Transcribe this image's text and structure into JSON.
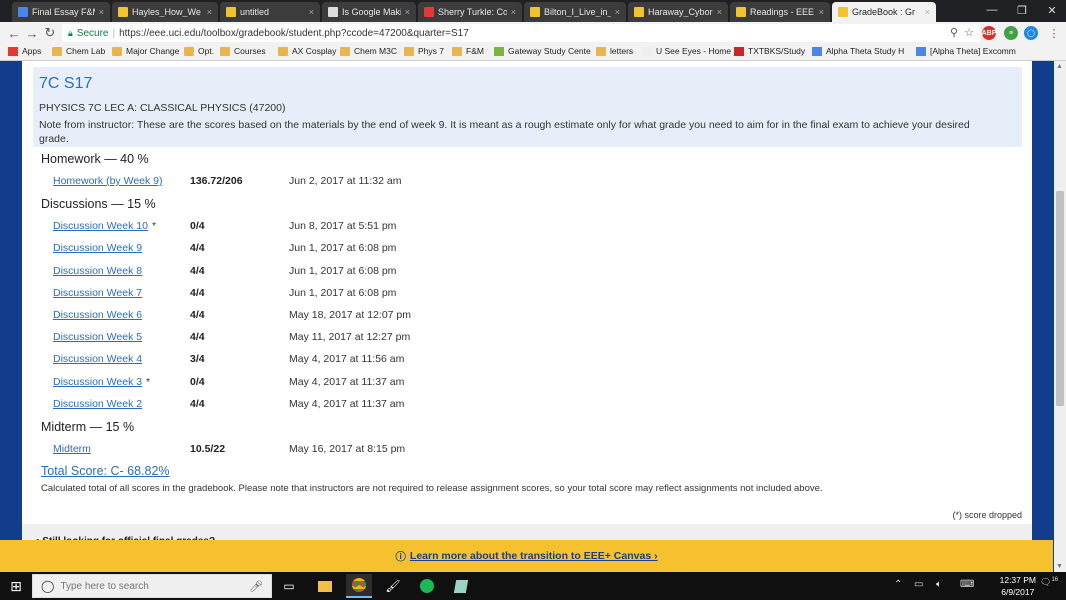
{
  "tabs": [
    {
      "label": "Final Essay F&M",
      "color": "#4a86e8"
    },
    {
      "label": "Hayles_How_We",
      "color": "#f1c232"
    },
    {
      "label": "untitled",
      "color": "#f1c232"
    },
    {
      "label": "Is Google Makin",
      "color": "#dddddd"
    },
    {
      "label": "Sherry Turkle: Co",
      "color": "#e53935"
    },
    {
      "label": "Bilton_I_Live_in_t",
      "color": "#f1c232"
    },
    {
      "label": "Haraway_Cyborg",
      "color": "#f1c232"
    },
    {
      "label": "Readings - EEE",
      "color": "#f1c232"
    },
    {
      "label": "GradeBook : Gr",
      "color": "#f1c232"
    }
  ],
  "window_controls": {
    "minimize": "—",
    "restore": "❐",
    "close": "✕"
  },
  "omnibox": {
    "secure_label": "Secure",
    "url": "https://eee.uci.edu/toolbox/gradebook/student.php?ccode=47200&quarter=S17"
  },
  "extensions": [
    {
      "label": "ABP",
      "color": "#d32f2f"
    },
    {
      "label": "≡",
      "color": "#43a047"
    },
    {
      "label": "◯",
      "color": "#1e88e5"
    }
  ],
  "bookmarks": [
    {
      "label": "Apps",
      "type": "apps"
    },
    {
      "label": "Chem Lab",
      "type": "folder"
    },
    {
      "label": "Major Change",
      "type": "folder"
    },
    {
      "label": "Opt.",
      "type": "folder"
    },
    {
      "label": "Courses",
      "type": "folder"
    },
    {
      "label": "AX Cosplay",
      "type": "folder"
    },
    {
      "label": "Chem M3C",
      "type": "folder"
    },
    {
      "label": "Phys 7",
      "type": "folder"
    },
    {
      "label": "F&M",
      "type": "folder"
    },
    {
      "label": "Gateway Study Cente",
      "type": "site"
    },
    {
      "label": "letters",
      "type": "folder"
    },
    {
      "label": "U See Eyes - Home",
      "type": "doc"
    },
    {
      "label": "TXTBKS/Study",
      "type": "gmail"
    },
    {
      "label": "Alpha Theta Study H",
      "type": "docs"
    },
    {
      "label": "[Alpha Theta] Excomm",
      "type": "docs"
    }
  ],
  "course": {
    "code": "7C S17",
    "name": "PHYSICS 7C LEC A: CLASSICAL PHYSICS (47200)",
    "note": "Note from instructor: These are the scores based on the materials by the end of week 9. It is meant as a rough estimate only for what grade you need to aim for in the final exam to achieve your desired grade."
  },
  "categories": [
    {
      "title": "Homework — 40 %",
      "items": [
        {
          "name": "Homework (by Week 9)",
          "dropped": "",
          "score": "136.72/206",
          "date": "Jun 2, 2017 at 11:32 am"
        }
      ]
    },
    {
      "title": "Discussions — 15 %",
      "items": [
        {
          "name": "Discussion Week 10",
          "dropped": "*",
          "score": "0/4",
          "date": "Jun 8, 2017 at 5:51 pm"
        },
        {
          "name": "Discussion Week 9",
          "dropped": "",
          "score": "4/4",
          "date": "Jun 1, 2017 at 6:08 pm"
        },
        {
          "name": "Discussion Week 8",
          "dropped": "",
          "score": "4/4",
          "date": "Jun 1, 2017 at 6:08 pm"
        },
        {
          "name": "Discussion Week 7",
          "dropped": "",
          "score": "4/4",
          "date": "Jun 1, 2017 at 6:08 pm"
        },
        {
          "name": "Discussion Week 6",
          "dropped": "",
          "score": "4/4",
          "date": "May 18, 2017 at 12:07 pm"
        },
        {
          "name": "Discussion Week 5",
          "dropped": "",
          "score": "4/4",
          "date": "May 11, 2017 at 12:27 pm"
        },
        {
          "name": "Discussion Week 4",
          "dropped": "",
          "score": "3/4",
          "date": "May 4, 2017 at 11:56 am"
        },
        {
          "name": "Discussion Week 3",
          "dropped": "*",
          "score": "0/4",
          "date": "May 4, 2017 at 11:37 am"
        },
        {
          "name": "Discussion Week 2",
          "dropped": "",
          "score": "4/4",
          "date": "May 4, 2017 at 11:37 am"
        }
      ]
    },
    {
      "title": "Midterm — 15 %",
      "items": [
        {
          "name": "Midterm",
          "dropped": "",
          "score": "10.5/22",
          "date": "May 16, 2017 at 8:15 pm"
        }
      ]
    }
  ],
  "total_score": "Total Score: C- 68.82%",
  "total_note": "Calculated total of all scores in the gradebook. Please note that instructors are not required to release assignment scores, so your total score may reflect assignments not included above.",
  "dropped_note": "(*) score dropped",
  "still_looking": "Still looking for official final grades?",
  "banner": {
    "label": "Learn more about the transition to EEE+ Canvas ›",
    "color": "#f6c12f"
  },
  "taskbar": {
    "search_placeholder": "Type here to search",
    "time": "12:37 PM",
    "date": "6/9/2017",
    "notification_count": "16"
  }
}
